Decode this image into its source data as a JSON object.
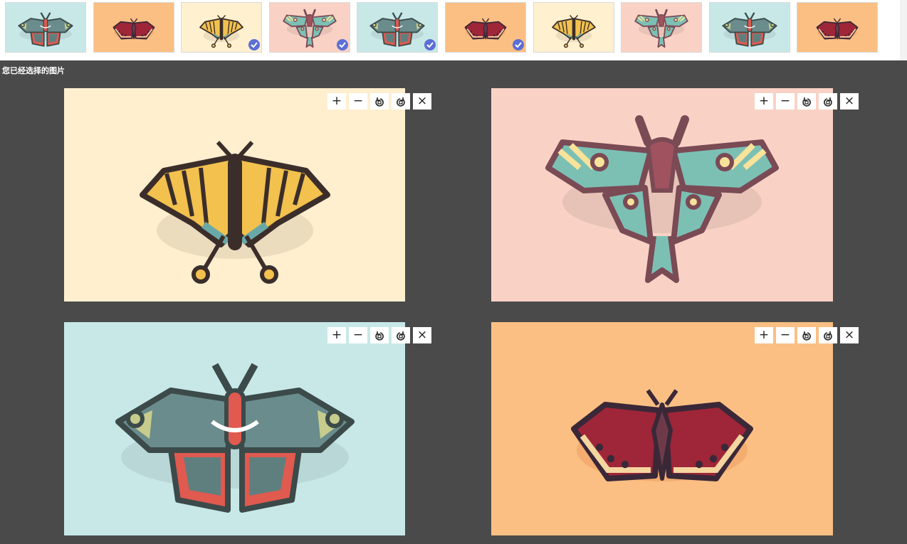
{
  "thumbnails": [
    {
      "bg": "#c8e8e8",
      "moth": "teal",
      "selected": false
    },
    {
      "bg": "#fbbf83",
      "moth": "red",
      "selected": false
    },
    {
      "bg": "#fff0cf",
      "moth": "yellow",
      "selected": true
    },
    {
      "bg": "#f9d2c5",
      "moth": "luna",
      "selected": true
    },
    {
      "bg": "#c8e8e8",
      "moth": "teal",
      "selected": true
    },
    {
      "bg": "#fbbf83",
      "moth": "red",
      "selected": true
    },
    {
      "bg": "#fff0cf",
      "moth": "yellow",
      "selected": false
    },
    {
      "bg": "#f9d2c5",
      "moth": "luna",
      "selected": false
    },
    {
      "bg": "#c8e8e8",
      "moth": "teal",
      "selected": false
    },
    {
      "bg": "#fbbf83",
      "moth": "red",
      "selected": false
    }
  ],
  "section_title": "您已经选择的图片",
  "toolbar": {
    "zoom_in": "+",
    "zoom_out": "−",
    "rotate_left_icon": "rotate-left-icon",
    "rotate_right_icon": "rotate-right-icon",
    "close": "×"
  },
  "selected": [
    {
      "bg": "#ffefcf",
      "moth": "yellow"
    },
    {
      "bg": "#f9d2c5",
      "moth": "luna"
    },
    {
      "bg": "#c8e8e8",
      "moth": "teal"
    },
    {
      "bg": "#fbbf83",
      "moth": "red"
    }
  ],
  "colors": {
    "check": "#5b6fd6",
    "dark_bg": "#4a4a4a"
  }
}
